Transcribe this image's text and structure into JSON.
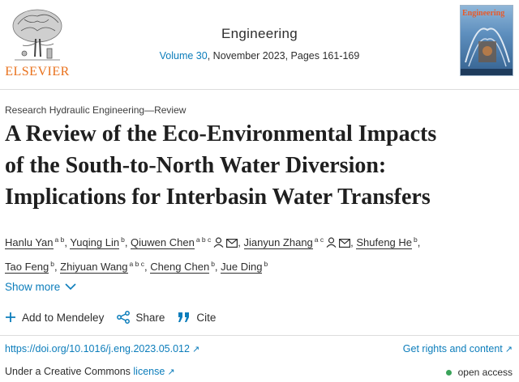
{
  "publisher": {
    "wordmark": "ELSEVIER"
  },
  "journal": {
    "title": "Engineering",
    "volume_link": "Volume 30",
    "issue_info": ", November 2023, Pages 161-169",
    "cover_title": "Engineering"
  },
  "article": {
    "section": "Research Hydraulic Engineering—Review",
    "title_line1": "A Review of the Eco-Environmental Impacts",
    "title_line2": "of the South-to-North Water Diversion:",
    "title_line3": "Implications for Interbasin Water Transfers"
  },
  "authors": [
    {
      "name": "Hanlu Yan",
      "sup": "a b",
      "contact": false
    },
    {
      "name": "Yuqing Lin",
      "sup": "b",
      "contact": false
    },
    {
      "name": "Qiuwen Chen",
      "sup": "a b c",
      "contact": true
    },
    {
      "name": "Jianyun Zhang",
      "sup": "a c",
      "contact": true
    },
    {
      "name": "Shufeng He",
      "sup": "b",
      "contact": false
    },
    {
      "name": "Tao Feng",
      "sup": "b",
      "contact": false
    },
    {
      "name": "Zhiyuan Wang",
      "sup": "a b c",
      "contact": false
    },
    {
      "name": "Cheng Chen",
      "sup": "b",
      "contact": false
    },
    {
      "name": "Jue Ding",
      "sup": "b",
      "contact": false
    }
  ],
  "controls": {
    "show_more": "Show more",
    "add_mendeley": "Add to Mendeley",
    "share": "Share",
    "cite": "Cite"
  },
  "links": {
    "doi": "https://doi.org/10.1016/j.eng.2023.05.012",
    "rights": "Get rights and content",
    "license_prefix": "Under a Creative Commons ",
    "license_link": "license",
    "open_access": "open access"
  },
  "colors": {
    "link": "#0c7dbb",
    "brand": "#e9711c",
    "open_access_dot": "#3aa35a"
  }
}
